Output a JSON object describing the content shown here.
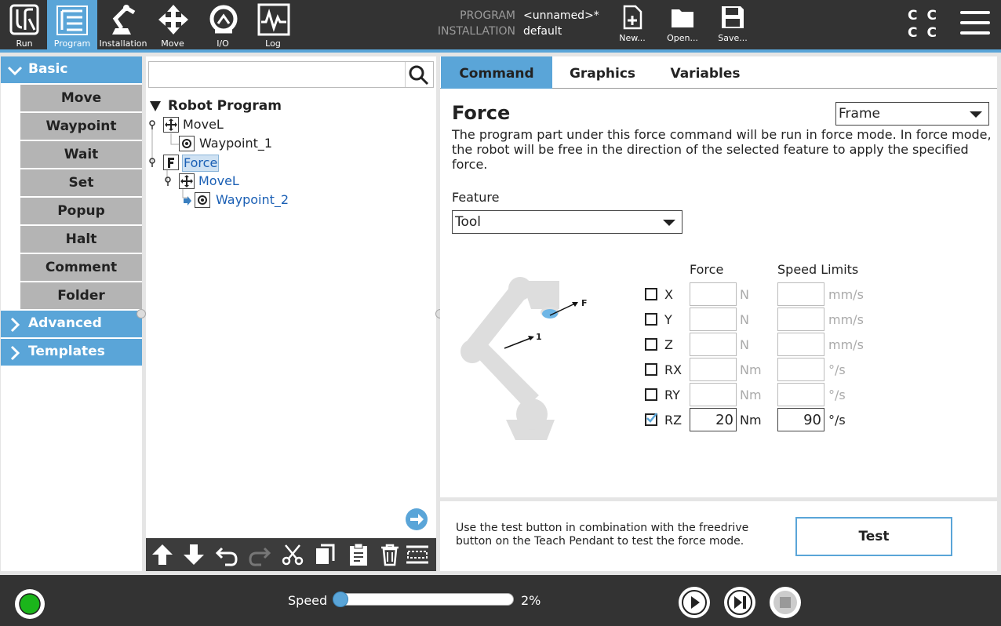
{
  "topbar": {
    "nav": [
      {
        "label": "Run",
        "icon": "ur-logo-icon"
      },
      {
        "label": "Program",
        "icon": "program-icon",
        "active": true
      },
      {
        "label": "Installation",
        "icon": "robot-arm-icon"
      },
      {
        "label": "Move",
        "icon": "move-arrows-icon"
      },
      {
        "label": "I/O",
        "icon": "io-icon"
      },
      {
        "label": "Log",
        "icon": "log-icon"
      }
    ],
    "program_key": "PROGRAM",
    "program_value": "<unnamed>*",
    "installation_key": "INSTALLATION",
    "installation_value": "default",
    "file_buttons": {
      "new": "New...",
      "open": "Open...",
      "save": "Save..."
    },
    "cc_label": "C C C C",
    "accent": "#5aa5d8"
  },
  "left_panel": {
    "basic": "Basic",
    "basic_items": [
      "Move",
      "Waypoint",
      "Wait",
      "Set",
      "Popup",
      "Halt",
      "Comment",
      "Folder"
    ],
    "advanced": "Advanced",
    "templates": "Templates"
  },
  "tree": {
    "search_placeholder": "",
    "nodes": {
      "root": "Robot Program",
      "movel1": "MoveL",
      "waypoint1": "Waypoint_1",
      "force": "Force",
      "movel2": "MoveL",
      "waypoint2": "Waypoint_2"
    }
  },
  "command": {
    "tabs": [
      "Command",
      "Graphics",
      "Variables"
    ],
    "title": "Force",
    "frame_select": "Frame",
    "description": "The program part under this force command will be run in force mode. In force mode, the robot will be free in the direction of the selected feature to apply the specified force.",
    "feature_label": "Feature",
    "feature_value": "Tool",
    "force_header": "Force",
    "speed_header": "Speed Limits",
    "diagram_labels": {
      "f": "F",
      "one": "1"
    },
    "axes": [
      {
        "name": "X",
        "checked": false,
        "force": "",
        "force_unit": "N",
        "speed": "",
        "speed_unit": "mm/s"
      },
      {
        "name": "Y",
        "checked": false,
        "force": "",
        "force_unit": "N",
        "speed": "",
        "speed_unit": "mm/s"
      },
      {
        "name": "Z",
        "checked": false,
        "force": "",
        "force_unit": "N",
        "speed": "",
        "speed_unit": "mm/s"
      },
      {
        "name": "RX",
        "checked": false,
        "force": "",
        "force_unit": "Nm",
        "speed": "",
        "speed_unit": "°/s"
      },
      {
        "name": "RY",
        "checked": false,
        "force": "",
        "force_unit": "Nm",
        "speed": "",
        "speed_unit": "°/s"
      },
      {
        "name": "RZ",
        "checked": true,
        "force": "20",
        "force_unit": "Nm",
        "speed": "90",
        "speed_unit": "°/s"
      }
    ]
  },
  "test_section": {
    "text": "Use the test button in combination with the freedrive button on the Teach Pendant to test the force mode.",
    "button": "Test"
  },
  "footer": {
    "speed_label": "Speed",
    "speed_value": "2%",
    "speed_fraction": 0.02,
    "status_color": "#1bb51b"
  }
}
